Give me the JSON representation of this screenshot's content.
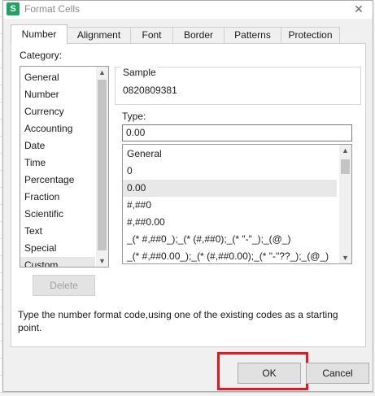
{
  "window": {
    "app_icon": "S",
    "title": "Format Cells",
    "close_glyph": "✕"
  },
  "tabs": [
    "Number",
    "Alignment",
    "Font",
    "Border",
    "Patterns",
    "Protection"
  ],
  "category": {
    "label": "Category:",
    "items": [
      "General",
      "Number",
      "Currency",
      "Accounting",
      "Date",
      "Time",
      "Percentage",
      "Fraction",
      "Scientific",
      "Text",
      "Special",
      "Custom"
    ],
    "selected": "Custom"
  },
  "delete_label": "Delete",
  "sample": {
    "label": "Sample",
    "value": "0820809381"
  },
  "type": {
    "label": "Type:",
    "value": "0.00",
    "formats": [
      "General",
      "0",
      "0.00",
      "#,##0",
      "#,##0.00",
      "_(* #,##0_);_(* (#,##0);_(* \"-\"_);_(@_)",
      "_(* #,##0.00_);_(* (#,##0.00);_(* \"-\"??_);_(@_)"
    ],
    "selected": "0.00"
  },
  "help_text": "Type the number format code,using one of the existing codes as a starting point.",
  "buttons": {
    "ok": "OK",
    "cancel": "Cancel"
  },
  "colors": {
    "app_icon": "#21a366",
    "highlight": "#e8151b",
    "selection": "#e8e8e8"
  }
}
